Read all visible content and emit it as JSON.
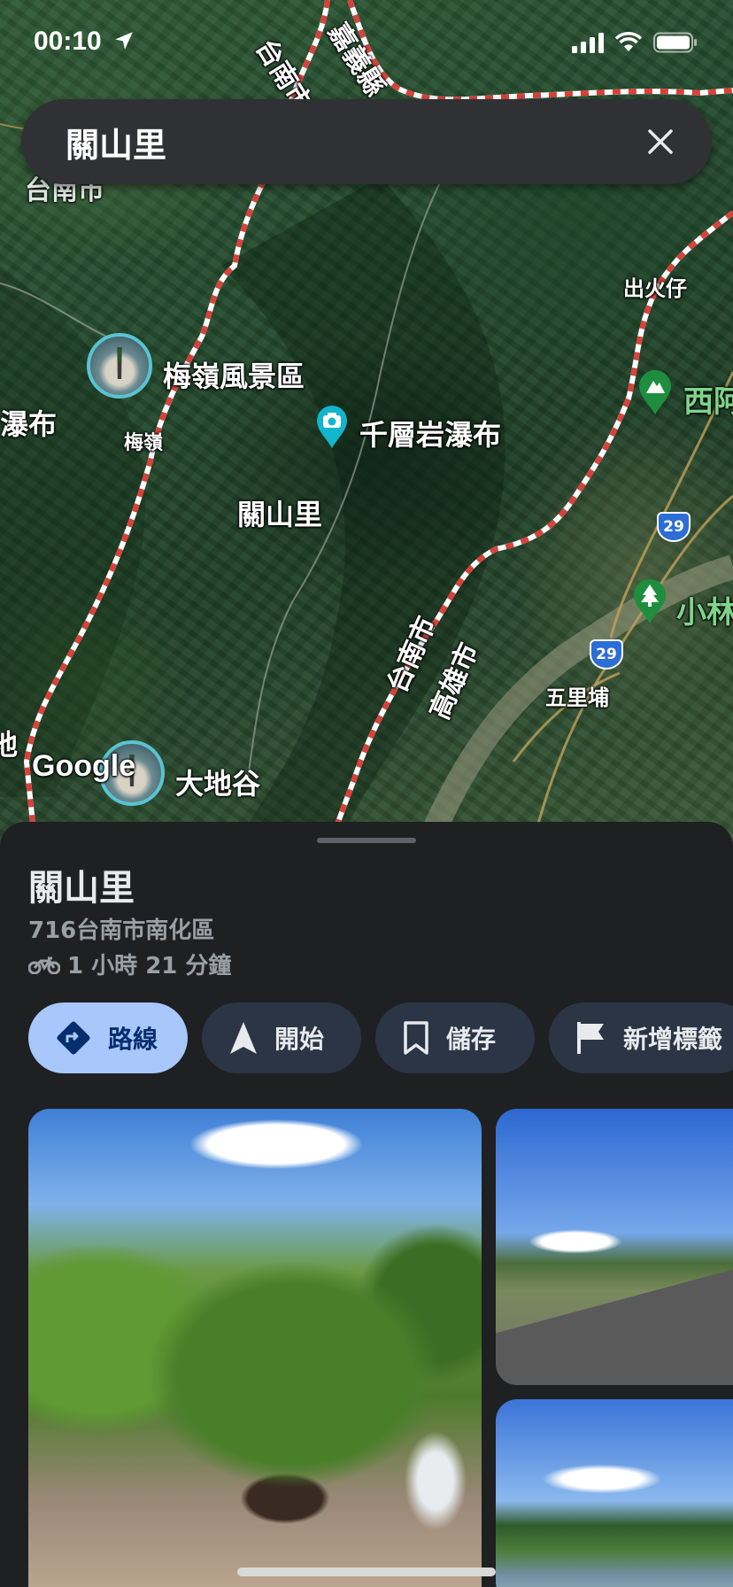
{
  "status_bar": {
    "time": "00:10"
  },
  "search": {
    "query": "關山里"
  },
  "map": {
    "watermark": "Google",
    "region_labels": {
      "chiayi": "嘉義縣",
      "tainan_top": "台南市",
      "tainan_left": "台南市",
      "tainan_border": "台南市",
      "kaohsiung_border": "高雄市"
    },
    "labels": {
      "meiling_area": "梅嶺風景區",
      "meiling": "梅嶺",
      "waterfall_left": "瀑布",
      "qianceng_waterfall": "千層岩瀑布",
      "guanshan": "關山里",
      "chuhuozai": "出火仔",
      "xia": "西阿",
      "xiaolin": "小林",
      "wulipu": "五里埔",
      "dadigu": "大地谷",
      "edge_left": "地"
    },
    "route_shields": [
      "29",
      "29"
    ]
  },
  "place": {
    "title": "關山里",
    "address": "716台南市南化區",
    "travel_time": "1 小時 21 分鐘"
  },
  "actions": [
    {
      "label": "路線",
      "icon": "directions-icon"
    },
    {
      "label": "開始",
      "icon": "navigation-arrow-icon"
    },
    {
      "label": "儲存",
      "icon": "bookmark-icon"
    },
    {
      "label": "新增標籤",
      "icon": "flag-icon"
    }
  ],
  "colors": {
    "accent": "#a8c7fa",
    "chip_bg": "#2b3545",
    "sheet_bg": "#1f2022",
    "search_bg": "#303134"
  }
}
